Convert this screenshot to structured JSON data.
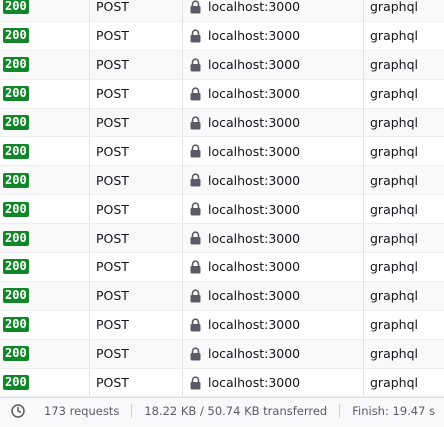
{
  "rows": [
    {
      "status": "200",
      "method": "POST",
      "domain": "localhost:3000",
      "file": "graphql"
    },
    {
      "status": "200",
      "method": "POST",
      "domain": "localhost:3000",
      "file": "graphql"
    },
    {
      "status": "200",
      "method": "POST",
      "domain": "localhost:3000",
      "file": "graphql"
    },
    {
      "status": "200",
      "method": "POST",
      "domain": "localhost:3000",
      "file": "graphql"
    },
    {
      "status": "200",
      "method": "POST",
      "domain": "localhost:3000",
      "file": "graphql"
    },
    {
      "status": "200",
      "method": "POST",
      "domain": "localhost:3000",
      "file": "graphql"
    },
    {
      "status": "200",
      "method": "POST",
      "domain": "localhost:3000",
      "file": "graphql"
    },
    {
      "status": "200",
      "method": "POST",
      "domain": "localhost:3000",
      "file": "graphql"
    },
    {
      "status": "200",
      "method": "POST",
      "domain": "localhost:3000",
      "file": "graphql"
    },
    {
      "status": "200",
      "method": "POST",
      "domain": "localhost:3000",
      "file": "graphql"
    },
    {
      "status": "200",
      "method": "POST",
      "domain": "localhost:3000",
      "file": "graphql"
    },
    {
      "status": "200",
      "method": "POST",
      "domain": "localhost:3000",
      "file": "graphql"
    },
    {
      "status": "200",
      "method": "POST",
      "domain": "localhost:3000",
      "file": "graphql"
    },
    {
      "status": "200",
      "method": "POST",
      "domain": "localhost:3000",
      "file": "graphql"
    }
  ],
  "icons": {
    "lock": "lock-icon",
    "statusbar": "clock-icon"
  },
  "colors": {
    "status_ok": "#12872a",
    "row_alt": "#f9f9fa"
  },
  "statusbar": {
    "requests": "173 requests",
    "transferred": "18.22 KB / 50.74 KB transferred",
    "finish": "Finish: 19.47 s"
  }
}
